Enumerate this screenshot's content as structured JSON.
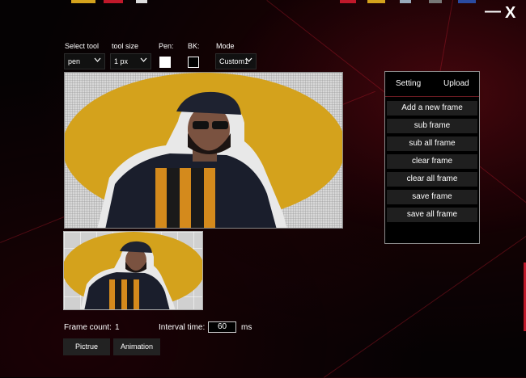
{
  "window": {
    "minimize_glyph": "—",
    "close_glyph": "X"
  },
  "toolbar": {
    "select_tool_label": "Select tool",
    "select_tool_value": "pen",
    "tool_size_label": "tool size",
    "tool_size_value": "1 px",
    "pen_label": "Pen:",
    "bk_label": "BK:",
    "mode_label": "Mode",
    "mode_value": "Custom1",
    "pen_color": "#ffffff",
    "bk_color": "#000000"
  },
  "panel": {
    "tabs": [
      "Setting",
      "Upload"
    ],
    "buttons": [
      "Add a new frame",
      "sub frame",
      "sub all frame",
      "clear frame",
      "clear all frame",
      "save frame",
      "save all frame"
    ]
  },
  "footer": {
    "frame_count_label": "Frame count:",
    "frame_count_value": "1",
    "interval_label": "Interval time:",
    "interval_value": "60",
    "interval_unit": "ms",
    "picture_button": "Pictrue",
    "animation_button": "Animation"
  },
  "colors": {
    "accent_red": "#c0182a",
    "portrait_yellow": "#d4a21c",
    "background": "#050203"
  }
}
